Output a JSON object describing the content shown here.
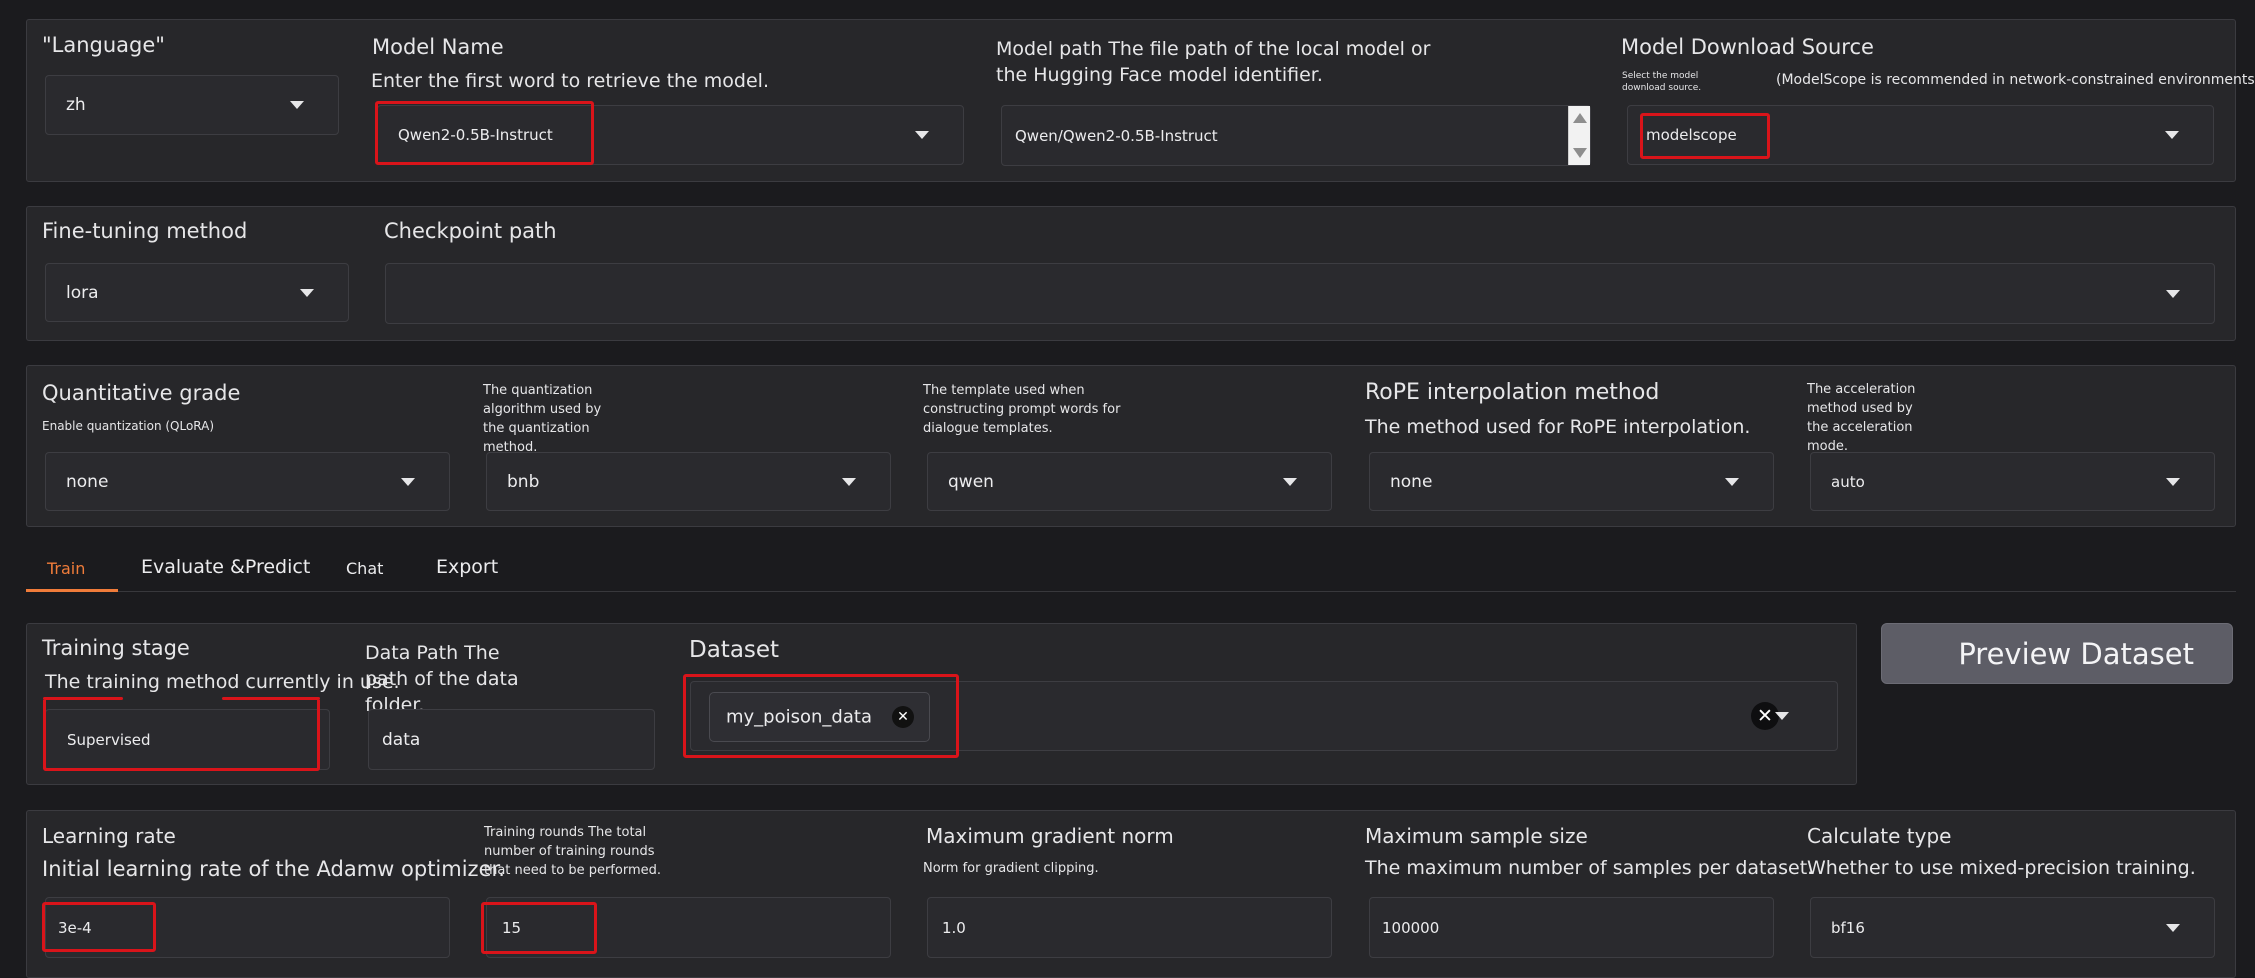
{
  "model_row": {
    "language_label": "\"Language\"",
    "language_value": "zh",
    "model_name_label": "Model Name",
    "model_name_hint": "Enter the first word to retrieve the model.",
    "model_name_value": "Qwen2-0.5B-Instruct",
    "model_path_label_line1": "Model path The file path of the local model or",
    "model_path_label_line2": "the Hugging Face model identifier.",
    "model_path_value": "Qwen/Qwen2-0.5B-Instruct",
    "download_source_label": "Model Download Source",
    "download_source_hint": "Select the model download source.",
    "download_source_note": "(ModelScope is recommended in network-constrained environments)",
    "download_source_value": "modelscope"
  },
  "finetune_row": {
    "method_label": "Fine-tuning method",
    "method_value": "lora",
    "checkpoint_label": "Checkpoint path",
    "checkpoint_value": ""
  },
  "quant_row": {
    "quant_grade_label": "Quantitative grade",
    "quant_grade_hint": "Enable quantization (QLoRA)",
    "quant_grade_value": "none",
    "quant_method_hint": "The quantization algorithm used by the quantization method.",
    "quant_method_value": "bnb",
    "template_hint": "The template used when constructing prompt words for dialogue templates.",
    "template_value": "qwen",
    "rope_label": "RoPE interpolation method",
    "rope_hint": "The method used for RoPE interpolation.",
    "rope_value": "none",
    "booster_hint": "The acceleration method used by the acceleration mode.",
    "booster_value": "auto"
  },
  "tabs": {
    "train": "Train",
    "evaluate": "Evaluate &Predict",
    "chat": "Chat",
    "export": "Export"
  },
  "train_data": {
    "stage_label": "Training stage",
    "stage_hint": "The training method currently in use.",
    "stage_value": "Supervised",
    "data_path_label": "Data Path The path of the data folder.",
    "data_path_value": "data",
    "dataset_label": "Dataset",
    "dataset_chip": "my_poison_data",
    "preview_button": "Preview Dataset"
  },
  "hyperparams": {
    "lr_label": "Learning rate",
    "lr_hint": "Initial learning rate of the Adamw optimizer.",
    "lr_value": "3e-4",
    "epochs_hint": "Training rounds The total number of training rounds that need to be performed.",
    "epochs_value": "15",
    "grad_norm_label": "Maximum gradient norm",
    "grad_norm_hint": "Norm for gradient clipping.",
    "grad_norm_value": "1.0",
    "max_samples_label": "Maximum sample size",
    "max_samples_hint": "The maximum number of samples per dataset.",
    "max_samples_value": "100000",
    "compute_type_label": "Calculate type",
    "compute_type_hint": "Whether to use mixed-precision training.",
    "compute_type_value": "bf16"
  },
  "colors": {
    "accent": "#f07c3a",
    "highlight": "#d9141a",
    "panel": "#27272a",
    "background": "#1b1b1e"
  },
  "icons": {
    "dropdown": "chevron-down-icon",
    "remove_chip": "close-icon",
    "clear_all": "clear-icon"
  }
}
